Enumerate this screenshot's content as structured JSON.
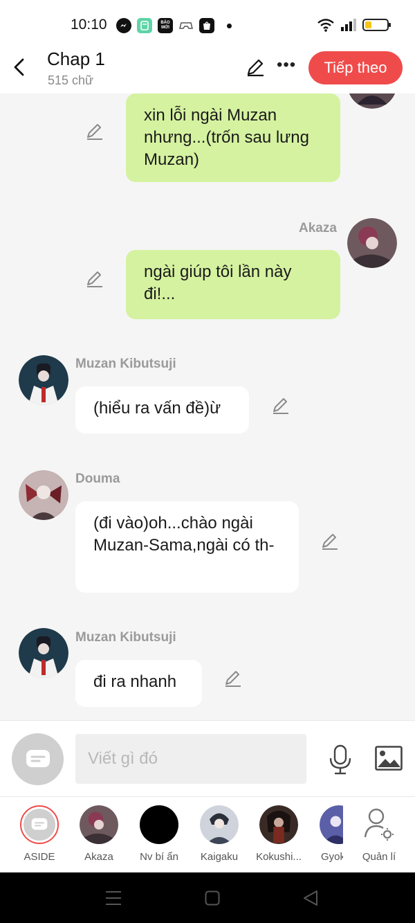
{
  "status_bar": {
    "time": "10:10",
    "app_icons": [
      "messenger-icon",
      "calculator-icon",
      "baomoi-icon",
      "game-icon",
      "shopee-icon"
    ],
    "baomoi_label": "BÁO MỚI",
    "battery_level": 0.3
  },
  "header": {
    "title": "Chap 1",
    "subtitle": "515 chữ",
    "next_label": "Tiếp theo"
  },
  "messages": [
    {
      "side": "right",
      "name": "",
      "text": "xin lỗi ngài Muzan nhưng...(trốn sau lưng Muzan)"
    },
    {
      "side": "right",
      "name": "Akaza",
      "text": "ngài giúp tôi lần này đi!..."
    },
    {
      "side": "left",
      "name": "Muzan Kibutsuji",
      "text": "(hiểu ra vấn đề)ừ"
    },
    {
      "side": "left",
      "name": "Douma",
      "text": "(đi vào)oh...chào ngài Muzan-Sama,ngài có th-"
    },
    {
      "side": "left",
      "name": "Muzan Kibutsuji",
      "text": "đi ra nhanh"
    }
  ],
  "input": {
    "placeholder": "Viết gì đó"
  },
  "characters": [
    {
      "label": "ASIDE"
    },
    {
      "label": "Akaza"
    },
    {
      "label": "Nv bí ẩn"
    },
    {
      "label": "Kaigaku"
    },
    {
      "label": "Kokushi..."
    },
    {
      "label": "Gyok"
    },
    {
      "label": "Quản lí"
    }
  ],
  "colors": {
    "accent": "#f04b4b",
    "bubble_right": "#d5f2a0",
    "bubble_left": "#ffffff"
  }
}
